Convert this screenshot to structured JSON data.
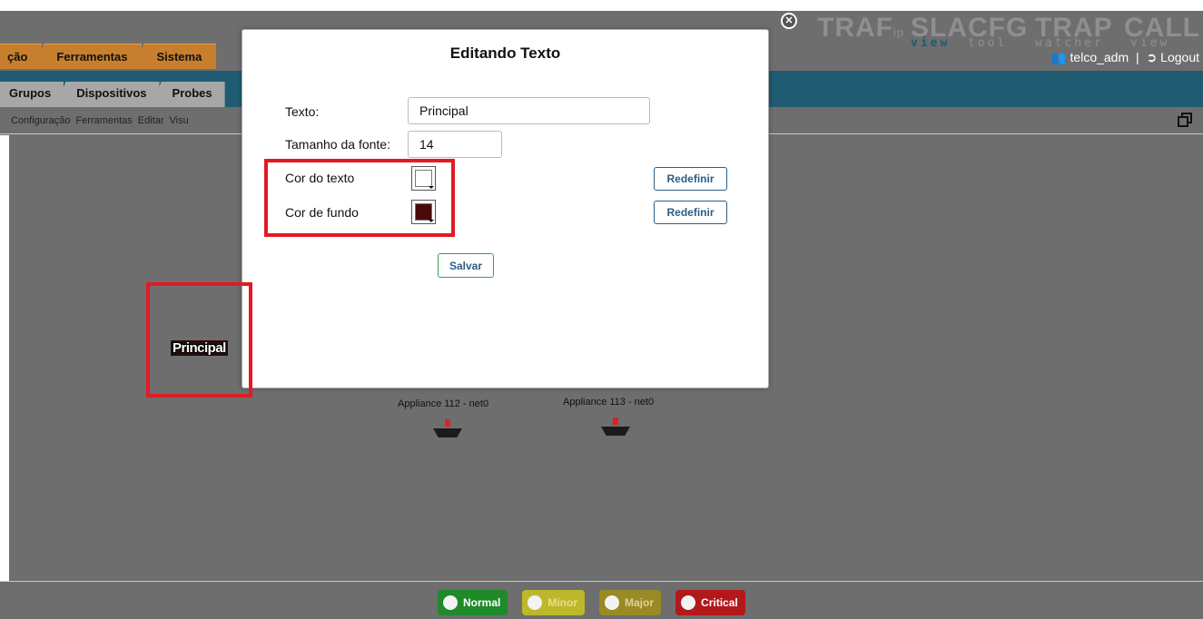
{
  "brand": {
    "products": [
      {
        "name": "TRAF",
        "suffix": "ip",
        "sub": ""
      },
      {
        "name": "SLA",
        "suffix": "",
        "sub": "view"
      },
      {
        "name": "CFG",
        "suffix": "",
        "sub": "tool"
      },
      {
        "name": "TRAP",
        "suffix": "",
        "sub": "watcher"
      },
      {
        "name": "CALL",
        "suffix": "",
        "sub": "view"
      }
    ]
  },
  "menu": {
    "tabs": [
      {
        "label": "ção"
      },
      {
        "label": "Ferramentas"
      },
      {
        "label": "Sistema"
      }
    ]
  },
  "user": {
    "username": "telco_adm",
    "separator": "|",
    "logout_label": "Logout"
  },
  "subtabs": [
    {
      "label": "Grupos"
    },
    {
      "label": "Dispositivos"
    },
    {
      "label": "Probes"
    }
  ],
  "toolbar": {
    "items": [
      {
        "label": "Configuração"
      },
      {
        "label": "Ferramentas"
      },
      {
        "label": "Editar"
      },
      {
        "label": "Visu"
      }
    ]
  },
  "map": {
    "text_label": "Principal",
    "devices": [
      {
        "label": "Appliance 112 - net0"
      },
      {
        "label": "Appliance 113 - net0"
      }
    ]
  },
  "legend": [
    {
      "label": "Normal",
      "color": "#1e8a2a"
    },
    {
      "label": "Minor",
      "color": "#bdb82b"
    },
    {
      "label": "Major",
      "color": "#9a8a24"
    },
    {
      "label": "Critical",
      "color": "#b3181b"
    }
  ],
  "dialog": {
    "title": "Editando Texto",
    "text_label": "Texto:",
    "text_value": "Principal",
    "font_size_label": "Tamanho da fonte:",
    "font_size_value": "14",
    "text_color_label": "Cor do texto",
    "text_color": "#ffffff",
    "bg_color_label": "Cor de fundo",
    "bg_color": "#4a0b0b",
    "reset_label": "Redefinir",
    "save_label": "Salvar"
  },
  "colors": {
    "highlight": "#e21a23",
    "accent": "#1f5c72",
    "menu_tab": "#c77f2e"
  }
}
